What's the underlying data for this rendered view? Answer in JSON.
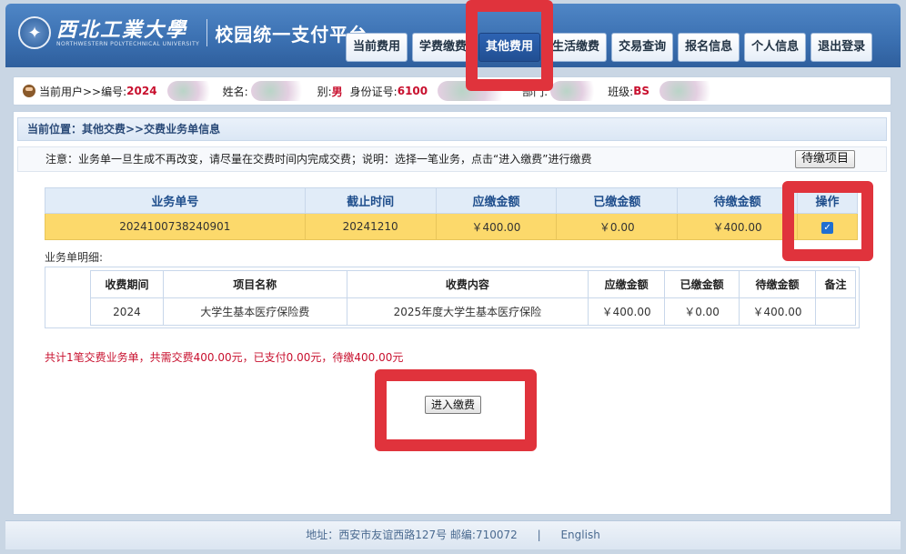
{
  "header": {
    "school_cn": "西北工業大學",
    "school_en": "NORTHWESTERN POLYTECHNICAL UNIVERSITY",
    "platform_title": "校园统一支付平台",
    "nav": [
      "当前费用",
      "学费缴费",
      "其他费用",
      "生活缴费",
      "交易查询",
      "报名信息",
      "个人信息",
      "退出登录"
    ],
    "active_nav": "其他费用"
  },
  "userbar": {
    "current_user_label": "当前用户>>编号:",
    "id_value": "2024",
    "name_label": "姓名:",
    "gender_label": "别:",
    "gender_value": "男",
    "idcard_label": "身份证号:",
    "idcard_value": "6100",
    "dept_label": "部门:",
    "class_label": "班级:",
    "class_value": "BS"
  },
  "breadcrumb": "当前位置：其他交费>>交费业务单信息",
  "notice": {
    "text": "注意：业务单一旦生成不再改变，请尽量在交费时间内完成交费；说明：选择一笔业务，点击“进入缴费”进行缴费",
    "pending_button": "待缴项目"
  },
  "order_table": {
    "headers": [
      "业务单号",
      "截止时间",
      "应缴金额",
      "已缴金额",
      "待缴金额",
      "操作"
    ],
    "row": {
      "order_no": "2024100738240901",
      "deadline": "20241210",
      "due": "￥400.00",
      "paid": "￥0.00",
      "pending": "￥400.00",
      "selected": true
    }
  },
  "detail": {
    "label": "业务单明细:",
    "headers": [
      "收费期间",
      "项目名称",
      "收费内容",
      "应缴金额",
      "已缴金额",
      "待缴金额",
      "备注"
    ],
    "row": {
      "period": "2024",
      "item": "大学生基本医疗保险费",
      "content": "2025年度大学生基本医疗保险",
      "due": "￥400.00",
      "paid": "￥0.00",
      "pending": "￥400.00",
      "remark": ""
    }
  },
  "summary": "共计1笔交费业务单，共需交费400.00元，已支付0.00元，待缴400.00元",
  "pay_button": "进入缴费",
  "footer": {
    "address": "地址：西安市友谊西路127号 邮编:710072",
    "separator": "|",
    "language": "English"
  }
}
